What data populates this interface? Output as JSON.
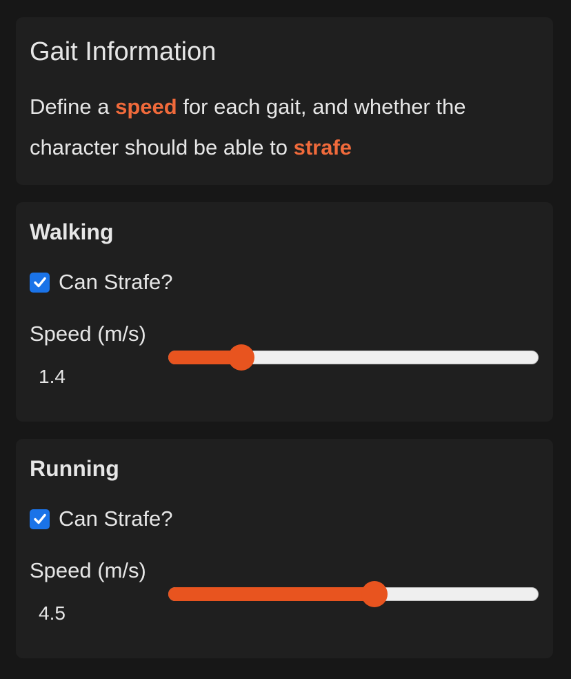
{
  "info": {
    "title": "Gait Information",
    "desc_part1": "Define a ",
    "desc_accent1": "speed",
    "desc_part2": " for each gait, and whether the character should be able to ",
    "desc_accent2": "strafe"
  },
  "gaits": [
    {
      "title": "Walking",
      "strafe_label": "Can Strafe?",
      "strafe_checked": true,
      "speed_label": "Speed (m/s)",
      "speed_value": "1.4",
      "slider_fraction": 0.198
    },
    {
      "title": "Running",
      "strafe_label": "Can Strafe?",
      "strafe_checked": true,
      "speed_label": "Speed (m/s)",
      "speed_value": "4.5",
      "slider_fraction": 0.557
    }
  ],
  "colors": {
    "accent": "#f06a3b",
    "slider": "#e8541f",
    "checkbox": "#1a73e8"
  }
}
